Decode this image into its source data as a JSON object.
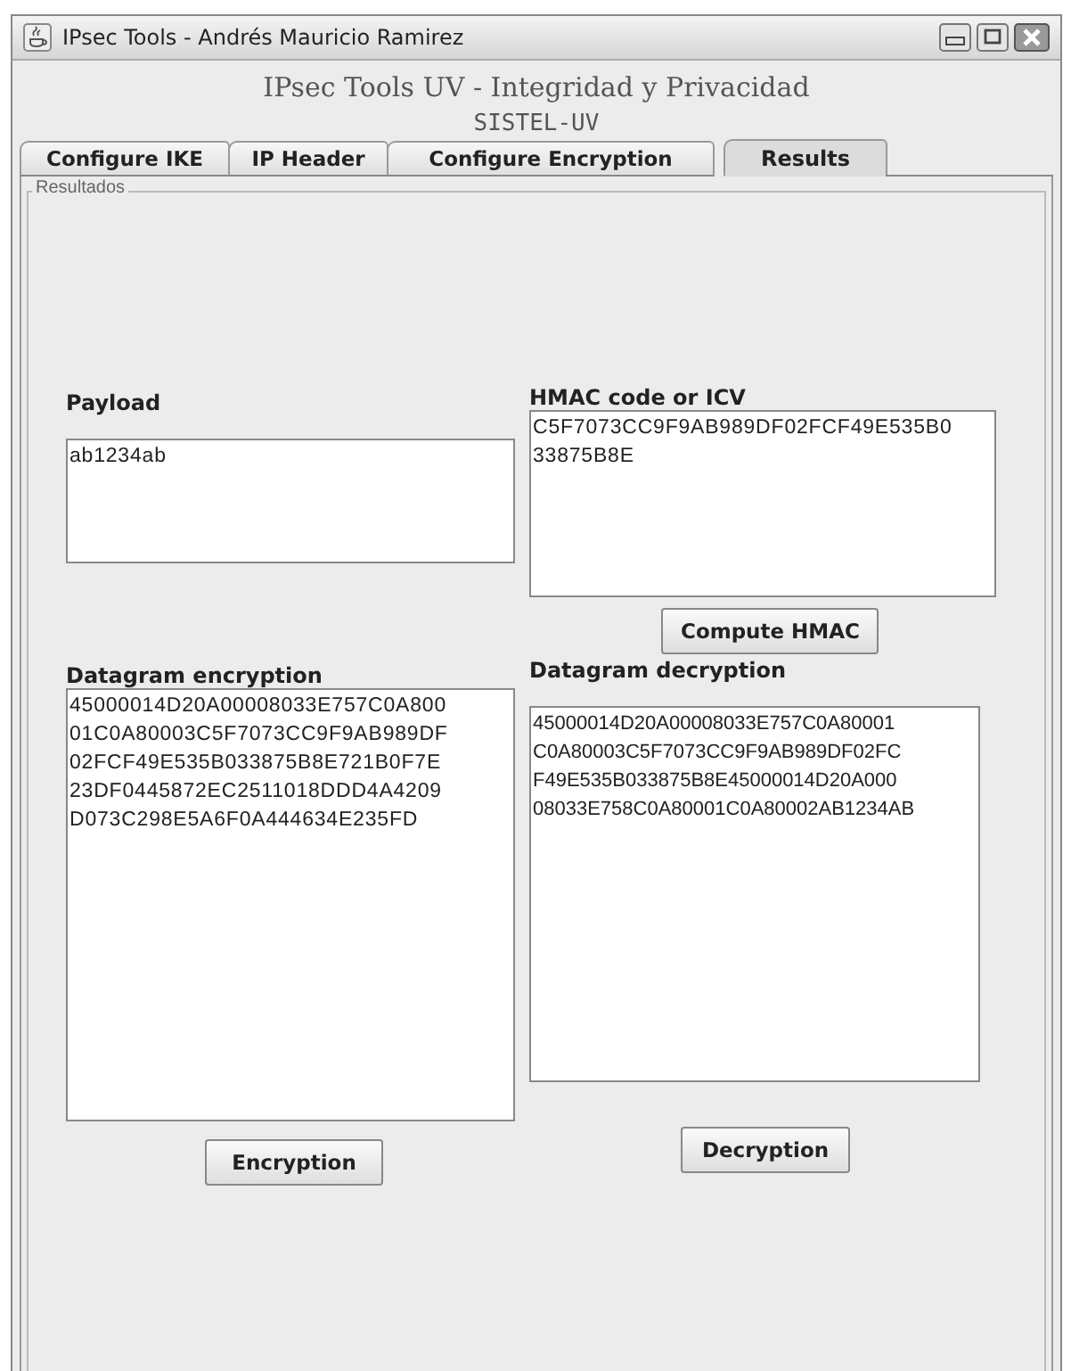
{
  "window": {
    "title": "IPsec Tools - Andrés Mauricio Ramirez"
  },
  "header": {
    "title": "IPsec Tools UV - Integridad y Privacidad",
    "subtitle": "SISTEL-UV"
  },
  "tabs": [
    {
      "label": "Configure IKE",
      "selected": false
    },
    {
      "label": "IP Header",
      "selected": false
    },
    {
      "label": "Configure Encryption",
      "selected": false
    },
    {
      "label": "Results",
      "selected": true
    }
  ],
  "group": {
    "title": "Resultados"
  },
  "payload": {
    "label": "Payload",
    "lines": [
      "ab1234ab"
    ]
  },
  "hmac": {
    "label": "HMAC code or ICV",
    "lines": [
      "C5F7073CC9F9AB989DF02FCF49E535B0",
      "33875B8E"
    ],
    "button": "Compute HMAC"
  },
  "encryption": {
    "label": "Datagram encryption",
    "lines": [
      "45000014D20A00008033E757C0A800",
      "01C0A80003C5F7073CC9F9AB989DF",
      "02FCF49E535B033875B8E721B0F7E",
      "23DF0445872EC2511018DDD4A4209",
      "D073C298E5A6F0A444634E235FD"
    ],
    "button": "Encryption"
  },
  "decryption": {
    "label": "Datagram decryption",
    "lines": [
      "45000014D20A00008033E757C0A80001",
      "C0A80003C5F7073CC9F9AB989DF02FC",
      "F49E535B033875B8E45000014D20A000",
      "08033E758C0A80001C0A80002AB1234AB"
    ],
    "button": "Decryption"
  }
}
